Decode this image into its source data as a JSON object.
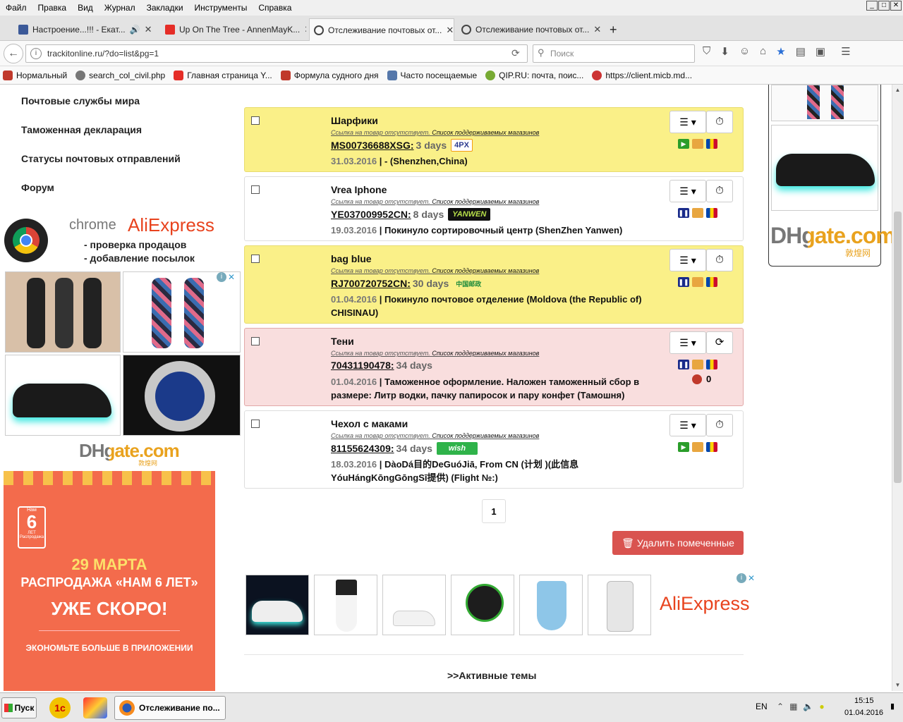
{
  "menubar": {
    "items": [
      "Файл",
      "Правка",
      "Вид",
      "Журнал",
      "Закладки",
      "Инструменты",
      "Справка"
    ]
  },
  "tabs": [
    {
      "title": "Настроение...!!! - Екат...",
      "fav_color": "#3b5998"
    },
    {
      "title": "Up On The Tree - AnnenMayK...",
      "fav_color": "#e52d27"
    },
    {
      "title": "Отслеживание почтовых от...",
      "fav_color": "#444444"
    },
    {
      "title": "Отслеживание почтовых от...",
      "fav_color": "#444444"
    }
  ],
  "new_tab_label": "+",
  "url": "trackitonline.ru/?do=list&pg=1",
  "search_placeholder": "Поиск",
  "bookmarks": [
    {
      "label": "Нормальный",
      "color": "#c0392b"
    },
    {
      "label": "search_col_civil.php",
      "color": "#777777"
    },
    {
      "label": "Главная страница Y...",
      "color": "#e52d27"
    },
    {
      "label": "Формула судного дня",
      "color": "#c0392b"
    },
    {
      "label": "Часто посещаемые",
      "color": "#5577aa"
    },
    {
      "label": "QIP.RU: почта, поис...",
      "color": "#77aa33"
    },
    {
      "label": "https://client.micb.md...",
      "color": "#cc3333"
    }
  ],
  "sidebar": {
    "links": [
      "Почтовые службы мира",
      "Таможенная декларация",
      "Статусы почтовых отправлений",
      "Форум"
    ],
    "promo": {
      "chrome": "chrome",
      "aliexpress": "AliExpress",
      "line1": "- проверка продацов",
      "line2": "- добавление посылок"
    },
    "dhgate": "DHgate.com",
    "dhgate_sub": "敦煌网",
    "sale_ad": {
      "badge_top": "Нам",
      "badge_num": "6",
      "badge_bottom": "ЛЕТ Распродажа",
      "date": "29 МАРТА",
      "title": "РАСПРОДАЖА «НАМ 6 ЛЕТ»",
      "soon": "УЖЕ СКОРО!",
      "footer": "ЭКОНОМЬТЕ БОЛЬШЕ В ПРИЛОЖЕНИИ"
    }
  },
  "link_missing": "Ссылка на товар отсутствует.",
  "link_shops": "Список поддерживаемых магазинов",
  "shipments": [
    {
      "name": "Шарфики",
      "track": "MS00736688XSG:",
      "days": "3 days",
      "carrier": "4PX",
      "date": "31.03.2016",
      "status": "- (Shenzhen,China)",
      "style": "y",
      "icon": "play",
      "action": "⏱"
    },
    {
      "name": "Vrea Iphone",
      "track": "YE037009952CN:",
      "days": "8 days",
      "carrier": "YANWEN",
      "date": "19.03.2016",
      "status": "Покинуло сортировочный центр (ShenZhen Yanwen)",
      "style": "w",
      "icon": "pause",
      "action": "⏱"
    },
    {
      "name": "bag blue",
      "track": "RJ700720752CN:",
      "days": "30 days",
      "carrier": "中国邮政",
      "date": "01.04.2016",
      "status": "Покинуло почтовое отделение (Moldova (the Republic of) CHISINAU)",
      "style": "y",
      "icon": "pause",
      "action": "⏱"
    },
    {
      "name": "Тени",
      "track": "70431190478:",
      "days": "34 days",
      "carrier": "",
      "date": "01.04.2016",
      "status": "Таможенное оформление. Наложен таможенный сбор в размере: Литр водки, пачку папиросок и пару конфет (Тамошня)",
      "style": "r",
      "icon": "pause",
      "action": "⟳",
      "count": "0"
    },
    {
      "name": "Чехол с маками",
      "track": "81155624309:",
      "days": "34 days",
      "carrier": "wish",
      "date": "18.03.2016",
      "status": "DàoDá目的DeGuóJiā, From CN (计划 )(此信息YóuHángKōngGōngSī提供) (Flight №:)",
      "style": "w",
      "icon": "play",
      "action": "⏱"
    }
  ],
  "menu_glyph": "☰ ▾",
  "date_sep": " | ",
  "pager": "1",
  "delete_button": "Удалить помеченные",
  "ad_strip": {
    "brand": "AliExpress"
  },
  "active_topics": ">>Активные темы",
  "taskbar": {
    "start": "Пуск",
    "window": "Отслеживание по...",
    "lang": "EN",
    "time": "15:15",
    "date": "01.04.2016"
  }
}
